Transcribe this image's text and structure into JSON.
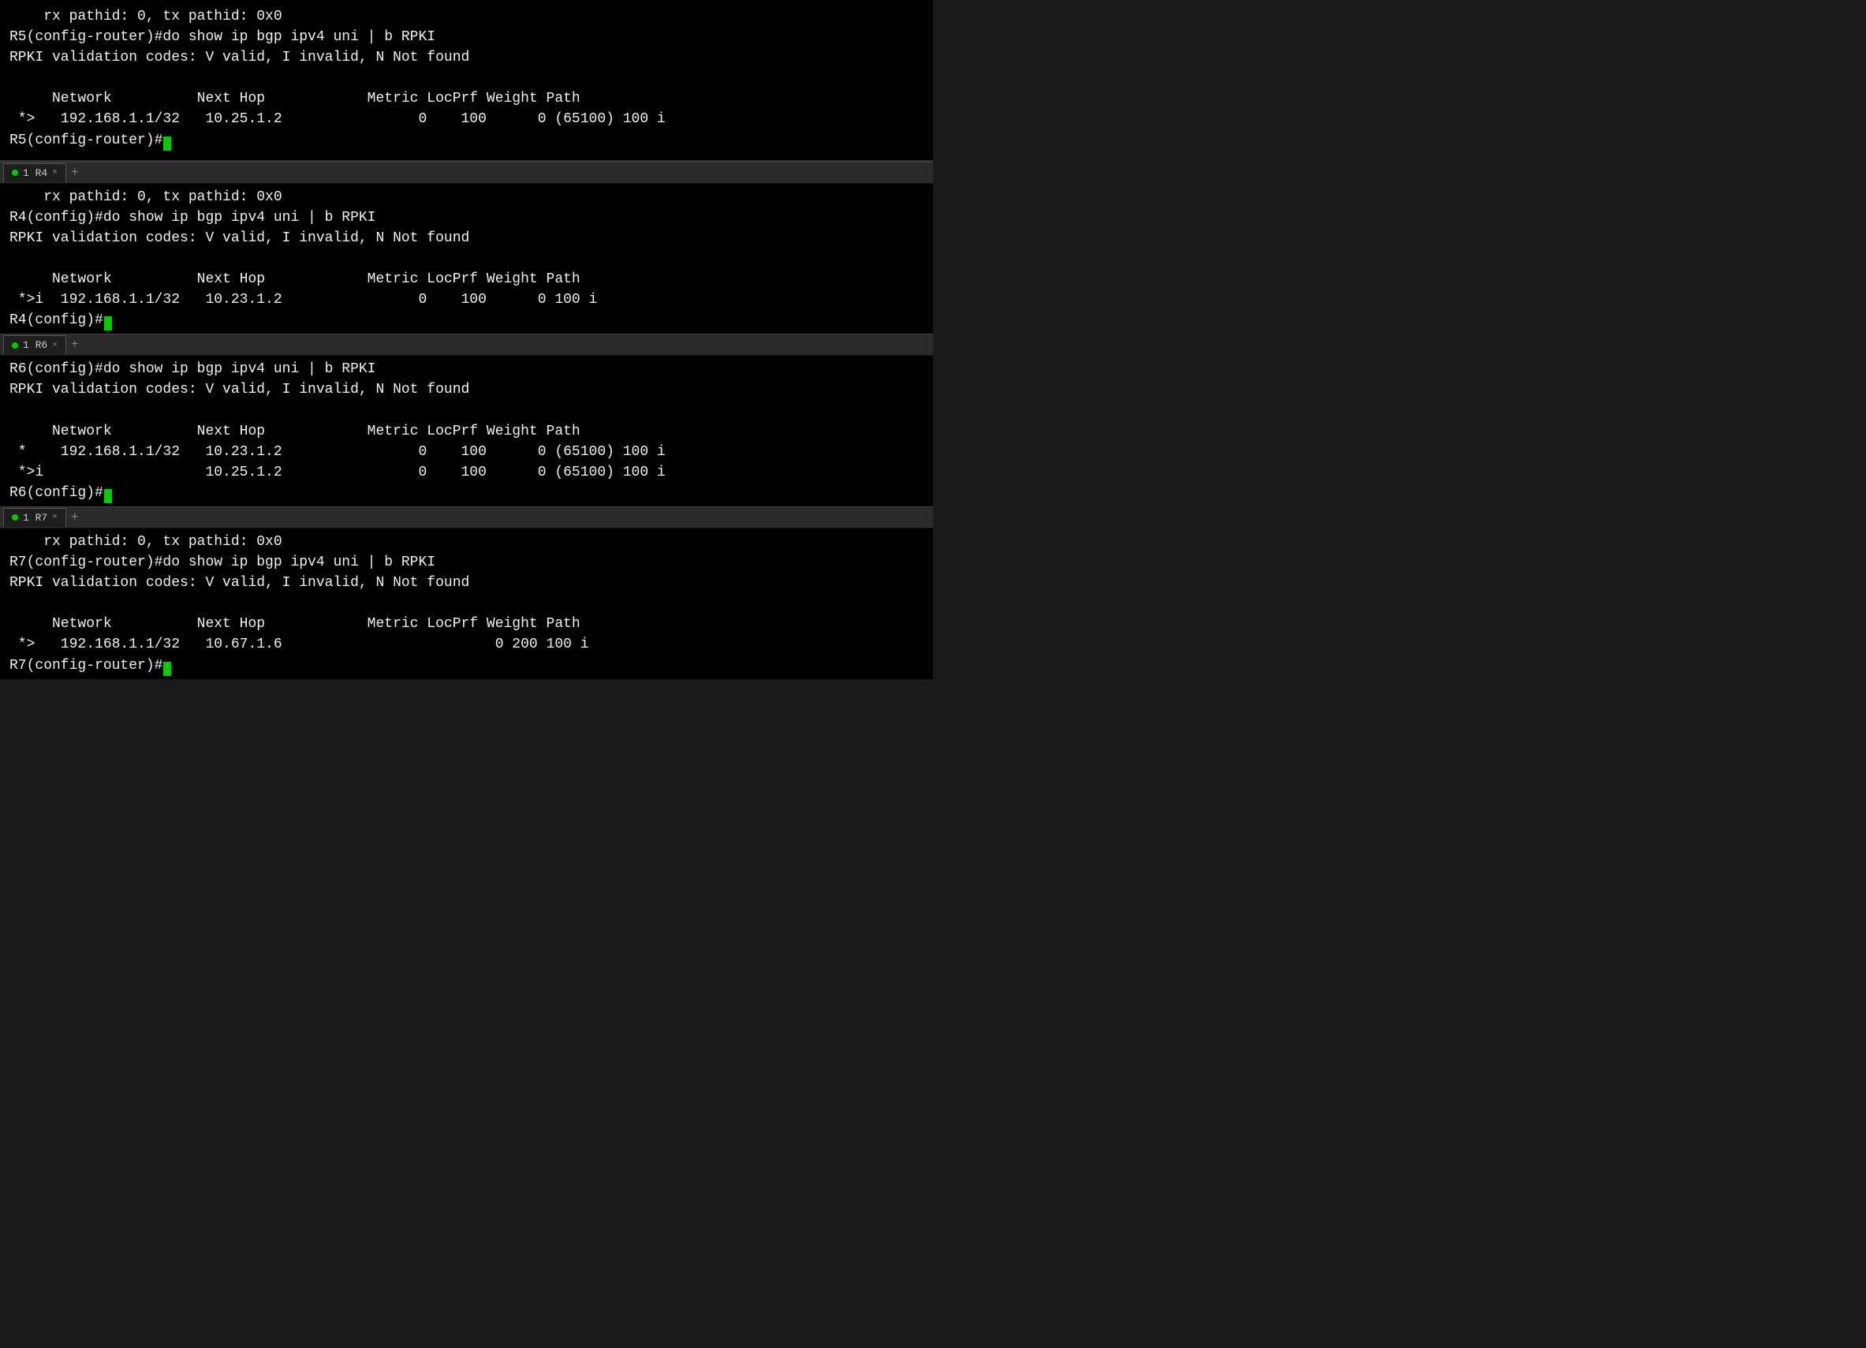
{
  "sections": [
    {
      "id": "section-top",
      "hasTab": false,
      "lines": [
        "    rx pathid: 0, tx pathid: 0x0",
        "R5(config-router)#do show ip bgp ipv4 uni | b RPKI",
        "RPKI validation codes: V valid, I invalid, N Not found",
        "",
        "     Network          Next Hop            Metric LocPrf Weight Path",
        " *>   192.168.1.1/32   10.25.1.2                0    100      0 (65100) 100 i",
        "R5(config-router)#"
      ],
      "cursorLine": 6,
      "cursorAfter": "R5(config-router)#"
    },
    {
      "id": "section-r4",
      "hasTab": true,
      "tabLabel": "1 R4",
      "lines": [
        "    rx pathid: 0, tx pathid: 0x0",
        "R4(config)#do show ip bgp ipv4 uni | b RPKI",
        "RPKI validation codes: V valid, I invalid, N Not found",
        "",
        "     Network          Next Hop            Metric LocPrf Weight Path",
        " *>i  192.168.1.1/32   10.23.1.2                0    100      0 100 i",
        "R4(config)#"
      ],
      "cursorLine": 6,
      "cursorAfter": "R4(config)#"
    },
    {
      "id": "section-r6",
      "hasTab": true,
      "tabLabel": "1 R6",
      "lines": [
        "R6(config)#do show ip bgp ipv4 uni | b RPKI",
        "RPKI validation codes: V valid, I invalid, N Not found",
        "",
        "     Network          Next Hop            Metric LocPrf Weight Path",
        " *    192.168.1.1/32   10.23.1.2                0    100      0 (65100) 100 i",
        " *>i                   10.25.1.2                0    100      0 (65100) 100 i",
        "R6(config)#"
      ],
      "cursorLine": 6,
      "cursorAfter": "R6(config)#"
    },
    {
      "id": "section-r7",
      "hasTab": true,
      "tabLabel": "1 R7",
      "lines": [
        "    rx pathid: 0, tx pathid: 0x0",
        "R7(config-router)#do show ip bgp ipv4 uni | b RPKI",
        "RPKI validation codes: V valid, I invalid, N Not found",
        "",
        "     Network          Next Hop            Metric LocPrf Weight Path",
        " *>   192.168.1.1/32   10.67.1.6                         0 200 100 i",
        "R7(config-router)#"
      ],
      "cursorLine": 6,
      "cursorAfter": "R7(config-router)#"
    }
  ]
}
